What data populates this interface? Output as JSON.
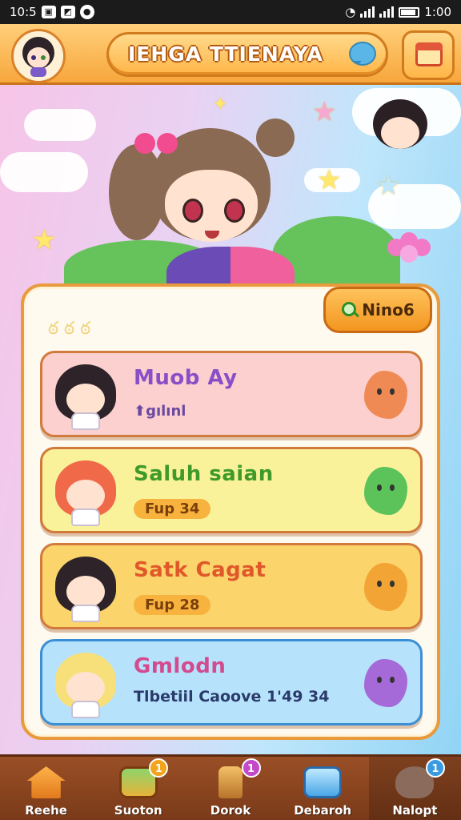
{
  "status_bar": {
    "time_left": "10:5",
    "time_right": "1:00"
  },
  "header": {
    "title": "IEHGA TTIENAYA"
  },
  "search_button": {
    "label": "Nino6"
  },
  "cards": [
    {
      "name": "Muob Ay",
      "subtitle": "⬆gılınl",
      "name_color": "#8a4fc7",
      "bg": "#fbd0cf",
      "blob_color": "#f08a54",
      "hair": "#2d2328"
    },
    {
      "name": "Saluh saian",
      "subtitle": "Fup 34",
      "name_color": "#3f9a2a",
      "bg": "#f9f29a",
      "blob_color": "#5cc25a",
      "hair": "#f06a4a"
    },
    {
      "name": "Satk Cagat",
      "subtitle": "Fup 28",
      "name_color_1": "#e0582a",
      "name_color_2": "#3b8fd6",
      "bg": "#fbd46b",
      "blob_color": "#f2a534",
      "hair": "#2d2328"
    },
    {
      "name": "Gmlodn",
      "subtitle": "Tlbetiil Caoove 1'49 34",
      "name_color": "#d44a8e",
      "bg": "#b6e2fb",
      "blob_color": "#a66ad8",
      "hair": "#f7e07a"
    }
  ],
  "bottom_nav": [
    {
      "label": "Reehe",
      "icon": "home-icon",
      "badge": ""
    },
    {
      "label": "Suoton",
      "icon": "treasure-map-icon",
      "badge": "1"
    },
    {
      "label": "Dorok",
      "icon": "flashlight-icon",
      "badge": "1"
    },
    {
      "label": "Debaroh",
      "icon": "globe-tablet-icon",
      "badge": ""
    },
    {
      "label": "Nalopt",
      "icon": "pet-rock-icon",
      "badge": "1"
    }
  ],
  "colors": {
    "accent": "#f7a73c",
    "nav_bg": "#8a4421",
    "panel_border": "#e89a3c"
  }
}
